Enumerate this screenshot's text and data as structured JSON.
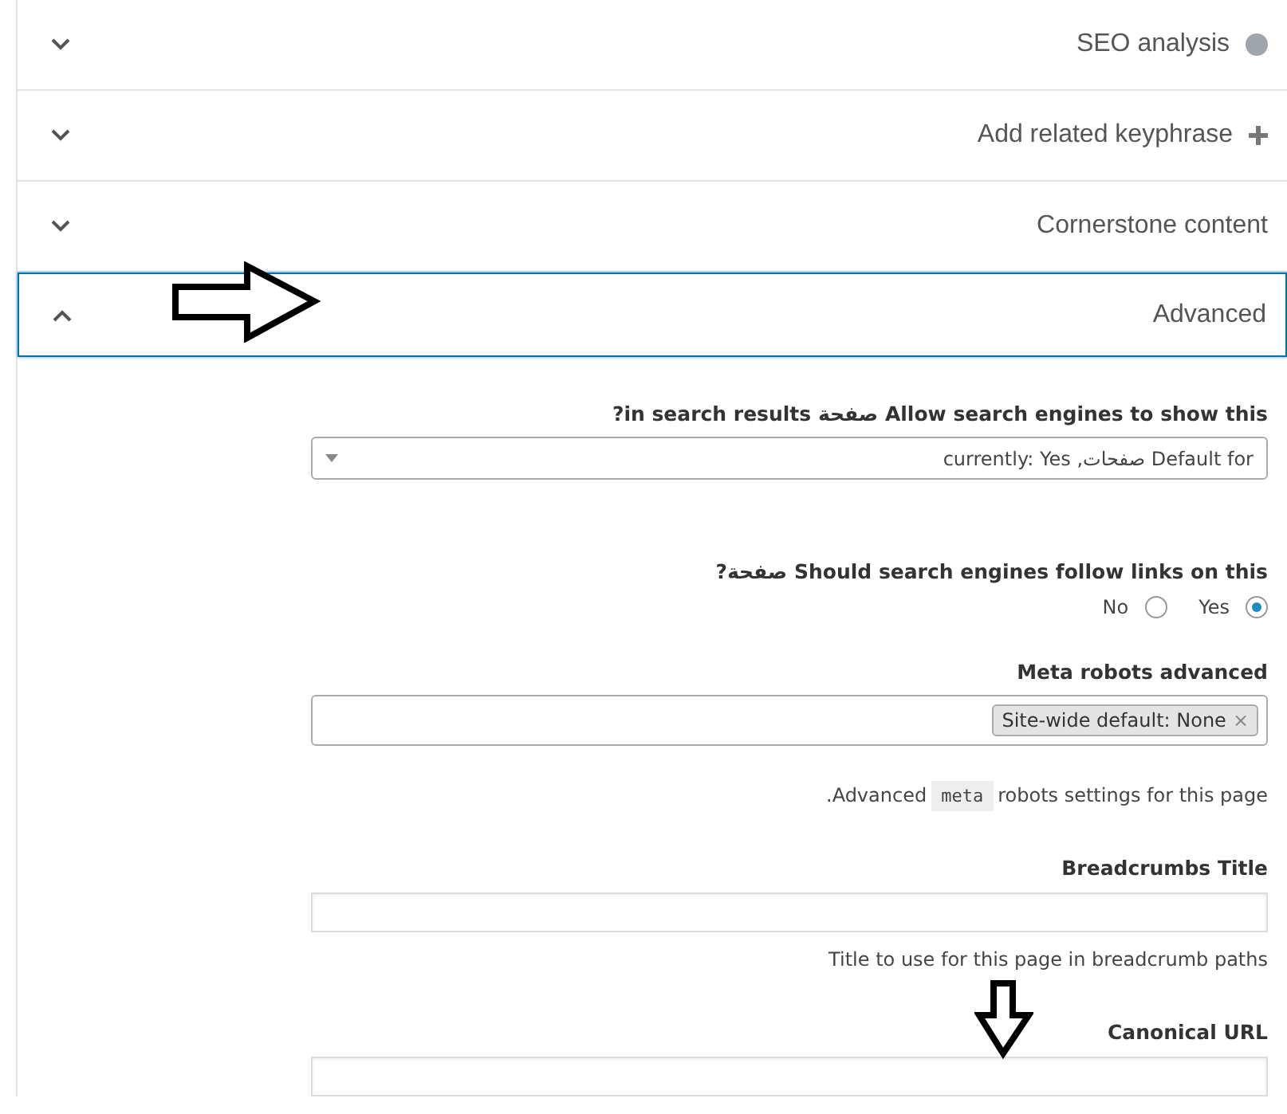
{
  "sections": [
    {
      "title": "SEO analysis",
      "kind": "dot",
      "expanded": false
    },
    {
      "title": "Add related keyphrase",
      "kind": "plus",
      "expanded": false
    },
    {
      "title": "Cornerstone content",
      "kind": "plain",
      "expanded": false
    },
    {
      "title": "Advanced",
      "kind": "plain",
      "expanded": true
    }
  ],
  "advanced": {
    "fields": [
      {
        "kind": "select",
        "label": "?in search results صفحة Allow search engines to show this",
        "value": "currently: Yes ,صفحات Default for"
      },
      {
        "kind": "radio",
        "label": "?صفحة Should search engines follow links on this",
        "options": [
          {
            "label": "No",
            "selected": false
          },
          {
            "label": "Yes",
            "selected": true
          }
        ]
      },
      {
        "kind": "tags",
        "label": "Meta robots advanced",
        "tags": [
          "Site-wide default: None"
        ],
        "remove": "×",
        "help_before": ".Advanced",
        "help_code": "meta",
        "help_after": "robots settings for this page"
      },
      {
        "kind": "text",
        "label": "Breadcrumbs Title",
        "help": "Title to use for this page in breadcrumb paths"
      },
      {
        "kind": "text",
        "label": "Canonical URL"
      }
    ]
  }
}
